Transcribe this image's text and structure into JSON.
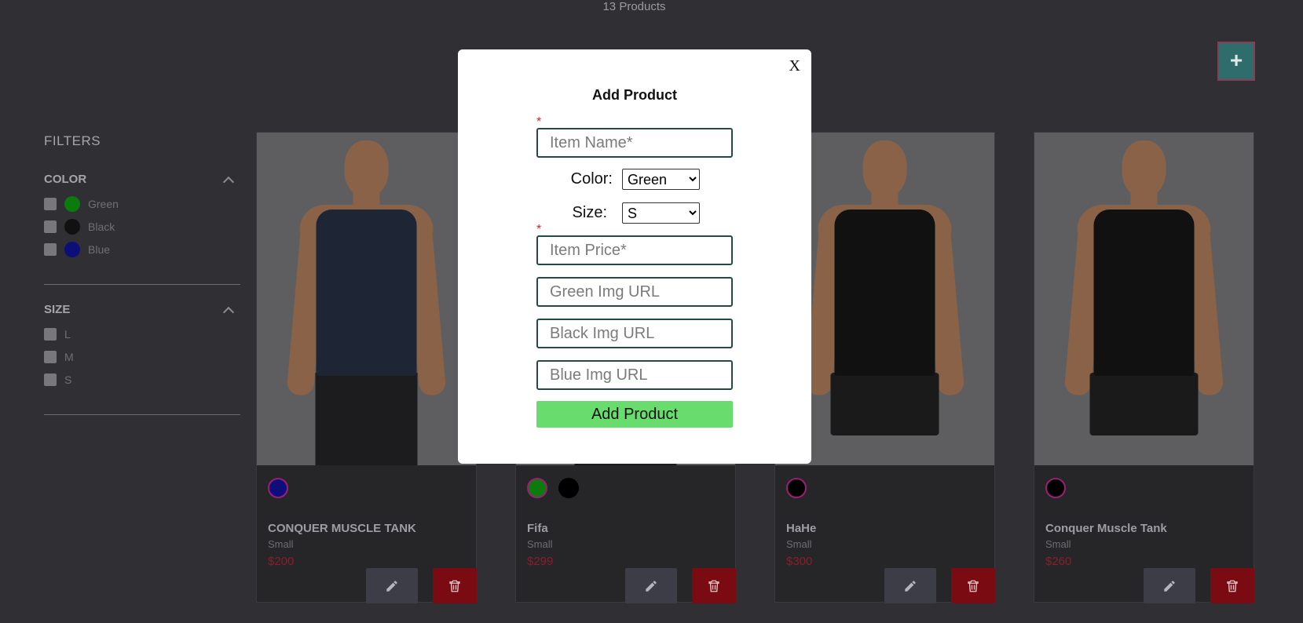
{
  "header": {
    "product_count": "13 Products"
  },
  "add_button": {
    "label": "+"
  },
  "filters": {
    "title": "FILTERS",
    "color": {
      "label": "COLOR",
      "options": [
        {
          "label": "Green",
          "swatch": "#0c7a0c"
        },
        {
          "label": "Black",
          "swatch": "#111111"
        },
        {
          "label": "Blue",
          "swatch": "#0e0e7a"
        }
      ]
    },
    "size": {
      "label": "SIZE",
      "options": [
        {
          "label": "L"
        },
        {
          "label": "M"
        },
        {
          "label": "S"
        }
      ]
    }
  },
  "products": [
    {
      "name": "CONQUER MUSCLE TANK",
      "size": "Small",
      "price": "$200",
      "shirt_color": "#1e2535",
      "bottom": "pants",
      "swatches": [
        "#0e0e7a"
      ]
    },
    {
      "name": "Fifa",
      "size": "Small",
      "price": "$299",
      "shirt_color": "#1e2535",
      "bottom": "pants",
      "swatches": [
        "#0c7a0c",
        "#000000"
      ]
    },
    {
      "name": "HaHe",
      "size": "Small",
      "price": "$300",
      "shirt_color": "#111111",
      "bottom": "shorts",
      "swatches": [
        "#000000"
      ]
    },
    {
      "name": "Conquer Muscle Tank",
      "size": "Small",
      "price": "$260",
      "shirt_color": "#111111",
      "bottom": "shorts",
      "swatches": [
        "#000000"
      ]
    }
  ],
  "modal": {
    "title": "Add Product",
    "close_label": "X",
    "required_mark": "*",
    "item_name_placeholder": "Item Name*",
    "color_label": "Color:",
    "color_value": "Green",
    "size_label": "Size:",
    "size_value": "S",
    "item_price_placeholder": "Item Price*",
    "green_url_placeholder": "Green Img URL",
    "black_url_placeholder": "Black Img URL",
    "blue_url_placeholder": "Blue Img URL",
    "submit_label": "Add Product"
  },
  "colors": {
    "modal_border": "#24484c",
    "submit": "#68dc6c",
    "delete": "#7a0b12",
    "price": "#8a1e2c"
  }
}
